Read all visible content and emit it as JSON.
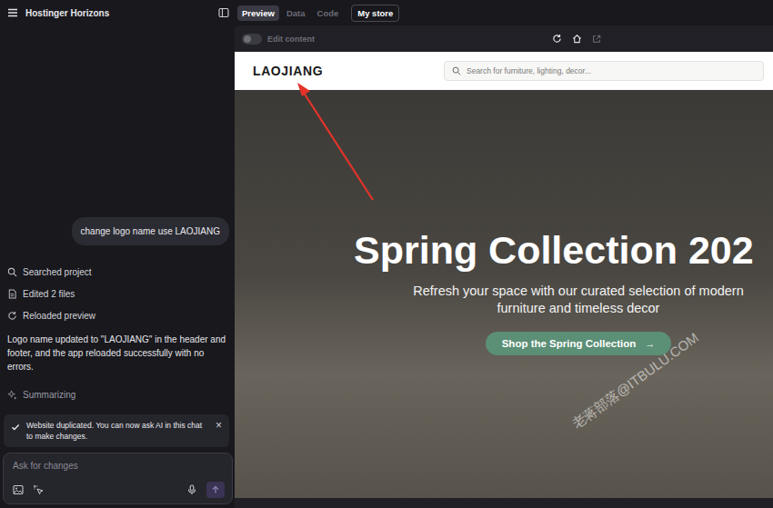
{
  "header": {
    "title": "Hostinger Horizons"
  },
  "tabs": [
    {
      "label": "Preview",
      "selected": true
    },
    {
      "label": "Data",
      "selected": false
    },
    {
      "label": "Code",
      "selected": false
    }
  ],
  "store_button": {
    "label": "My store"
  },
  "chat": {
    "user_message": "change logo name use LAOJIANG",
    "steps": [
      {
        "label": "Searched project",
        "kind": "search"
      },
      {
        "label": "Edited 2 files",
        "kind": "file"
      },
      {
        "label": "Reloaded preview",
        "kind": "reload"
      }
    ],
    "reply": "Logo name updated to \"LAOJIANG\" in the header and footer, and the app reloaded successfully with no errors.",
    "status": {
      "label": "Summarizing"
    }
  },
  "toast": {
    "message": "Website duplicated. You can now ask AI in this chat to make changes.",
    "close": "×"
  },
  "composer": {
    "placeholder": "Ask for changes"
  },
  "preview_toolbar": {
    "edit_toggle": {
      "label": "Edit content",
      "on": false
    }
  },
  "site": {
    "logo": "LAOJIANG",
    "search_placeholder": "Search for furniture, lighting, decor...",
    "hero": {
      "title": "Spring Collection 202",
      "subtitle": "Refresh your space with our curated selection of modern furniture and timeless decor",
      "button": {
        "label": "Shop the Spring Collection",
        "arrow": "→"
      }
    }
  },
  "watermark": "老蒋部落@ITBULU.COM"
}
